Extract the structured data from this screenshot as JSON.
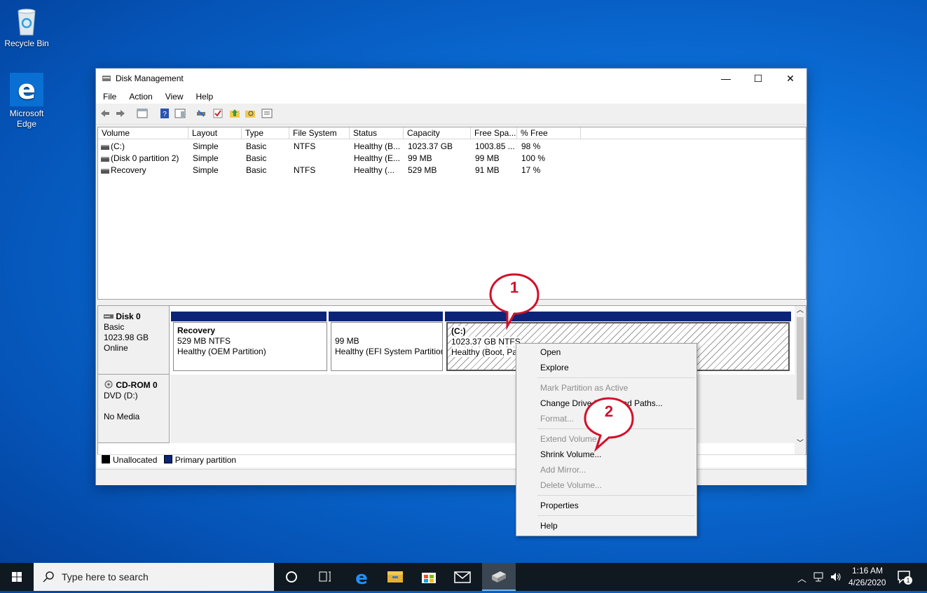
{
  "desktop": {
    "icons": [
      {
        "label": "Recycle Bin",
        "icon": "recycle-bin-icon"
      },
      {
        "label": "Microsoft Edge",
        "icon": "edge-icon"
      }
    ]
  },
  "window": {
    "title": "Disk Management",
    "controls": {
      "minimize": "—",
      "maximize": "☐",
      "close": "✕"
    },
    "menu": [
      "File",
      "Action",
      "View",
      "Help"
    ],
    "columns": [
      "Volume",
      "Layout",
      "Type",
      "File System",
      "Status",
      "Capacity",
      "Free Spa...",
      "% Free"
    ],
    "rows": [
      [
        "(C:)",
        "Simple",
        "Basic",
        "NTFS",
        "Healthy (B...",
        "1023.37 GB",
        "1003.85 ...",
        "98 %"
      ],
      [
        "(Disk 0 partition 2)",
        "Simple",
        "Basic",
        "",
        "Healthy (E...",
        "99 MB",
        "99 MB",
        "100 %"
      ],
      [
        "Recovery",
        "Simple",
        "Basic",
        "NTFS",
        "Healthy (...",
        "529 MB",
        "91 MB",
        "17 %"
      ]
    ],
    "disks": [
      {
        "name": "Disk 0",
        "line1": "Basic",
        "line2": "1023.98 GB",
        "line3": "Online"
      },
      {
        "name": "CD-ROM 0",
        "line1": "DVD (D:)",
        "line2": "",
        "line3": "No Media"
      }
    ],
    "partitions": [
      {
        "name": "Recovery",
        "size": "529 MB NTFS",
        "status": "Healthy (OEM Partition)"
      },
      {
        "name": "",
        "size": "99 MB",
        "status": "Healthy (EFI System Partition)"
      },
      {
        "name": "(C:)",
        "size": "1023.37 GB NTFS",
        "status": "Healthy (Boot, Page File, Crash Dump, Primary Partition)"
      }
    ],
    "legend": [
      {
        "label": "Unallocated",
        "color": "#000000"
      },
      {
        "label": "Primary partition",
        "color": "#0c2478"
      }
    ]
  },
  "context_menu": {
    "items": [
      {
        "label": "Open",
        "enabled": true
      },
      {
        "label": "Explore",
        "enabled": true
      },
      {
        "label": "Mark Partition as Active",
        "enabled": false
      },
      {
        "label": "Change Drive Letter and Paths...",
        "enabled": true
      },
      {
        "label": "Format...",
        "enabled": false
      },
      {
        "label": "Extend Volume...",
        "enabled": false
      },
      {
        "label": "Shrink Volume...",
        "enabled": true
      },
      {
        "label": "Add Mirror...",
        "enabled": false
      },
      {
        "label": "Delete Volume...",
        "enabled": false
      },
      {
        "label": "Properties",
        "enabled": true
      },
      {
        "label": "Help",
        "enabled": true
      }
    ]
  },
  "callouts": [
    "1",
    "2"
  ],
  "taskbar": {
    "search_placeholder": "Type here to search",
    "time": "1:16 AM",
    "date": "4/26/2020",
    "notification_count": "1"
  },
  "colors": {
    "primary_partition": "#0c2478",
    "callout": "#d1102a",
    "desktop": "#0b6fd8"
  }
}
